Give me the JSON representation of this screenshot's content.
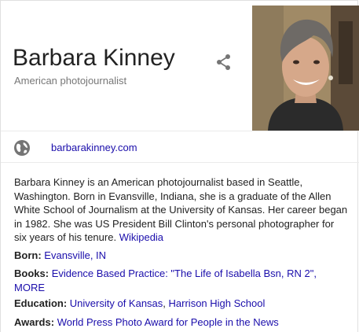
{
  "header": {
    "title": "Barbara Kinney",
    "subtitle": "American photojournalist"
  },
  "website": {
    "label": "barbarakinney.com"
  },
  "description": {
    "lines": [
      "Barbara Kinney is an American photojournalist based in Seattle,",
      "Washington. Born in Evansville, Indiana, she is a graduate of the Allen",
      "White School of Journalism at the University of Kansas. Her career began",
      "in 1982. She was US President Bill Clinton's personal photographer for",
      "six years of his tenure."
    ],
    "source_link": "Wikipedia"
  },
  "facts": {
    "born_label": "Born:",
    "born_value": "Evansville, IN",
    "books_label": "Books:",
    "books_value": "Evidence Based Practice: \"The Life of Isabella Bsn, RN 2\",",
    "books_more": "MORE",
    "education_label": "Education:",
    "education_value_1": "University of Kansas",
    "education_sep": ", ",
    "education_value_2": "Harrison High School",
    "awards_label": "Awards:",
    "awards_value": "World Press Photo Award for People in the News"
  },
  "icons": {
    "share": "share-icon",
    "globe": "globe-icon"
  },
  "colors": {
    "link": "#1a0dab",
    "subtitle": "#777777",
    "text": "#222222"
  }
}
